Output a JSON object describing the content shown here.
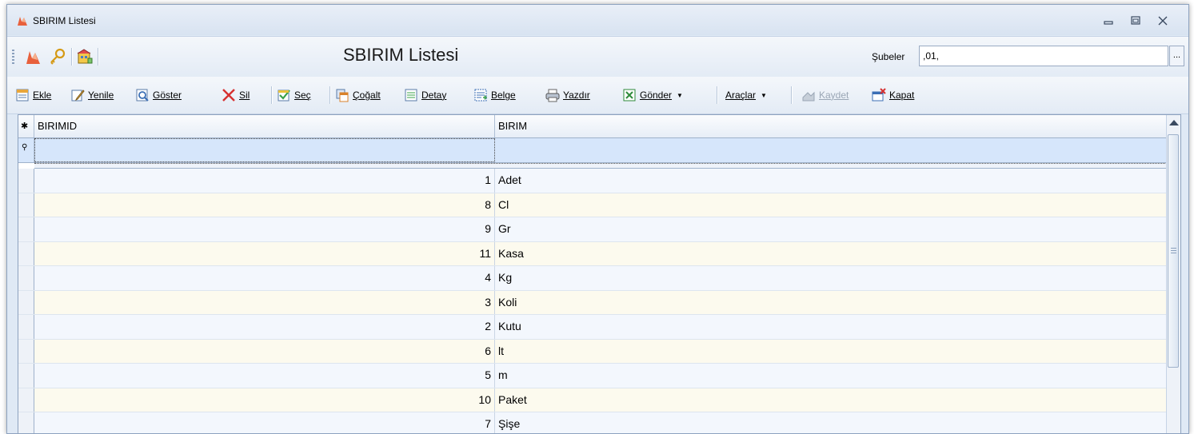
{
  "window": {
    "title": "SBIRIM Listesi"
  },
  "header": {
    "title": "SBIRIM Listesi",
    "subeler_label": "Şubeler",
    "subeler_value": ",01,",
    "ellipsis": "..."
  },
  "toolbar": {
    "ekle": "Ekle",
    "yenile": "Yenile",
    "goster": "Göster",
    "sil": "Sil",
    "sec": "Seç",
    "cogalt": "Çoğalt",
    "detay": "Detay",
    "belge": "Belge",
    "yazdir": "Yazdır",
    "gonder": "Gönder",
    "araclar": "Araçlar",
    "kaydet": "Kaydet",
    "kapat": "Kapat"
  },
  "grid": {
    "columns": [
      "BIRIMID",
      "BIRIM"
    ],
    "rows": [
      {
        "id": "1",
        "name": "Adet"
      },
      {
        "id": "8",
        "name": "Cl"
      },
      {
        "id": "9",
        "name": "Gr"
      },
      {
        "id": "11",
        "name": "Kasa"
      },
      {
        "id": "4",
        "name": "Kg"
      },
      {
        "id": "3",
        "name": "Koli"
      },
      {
        "id": "2",
        "name": "Kutu"
      },
      {
        "id": "6",
        "name": "lt"
      },
      {
        "id": "5",
        "name": "m"
      },
      {
        "id": "10",
        "name": "Paket"
      },
      {
        "id": "7",
        "name": "Şişe"
      }
    ]
  }
}
